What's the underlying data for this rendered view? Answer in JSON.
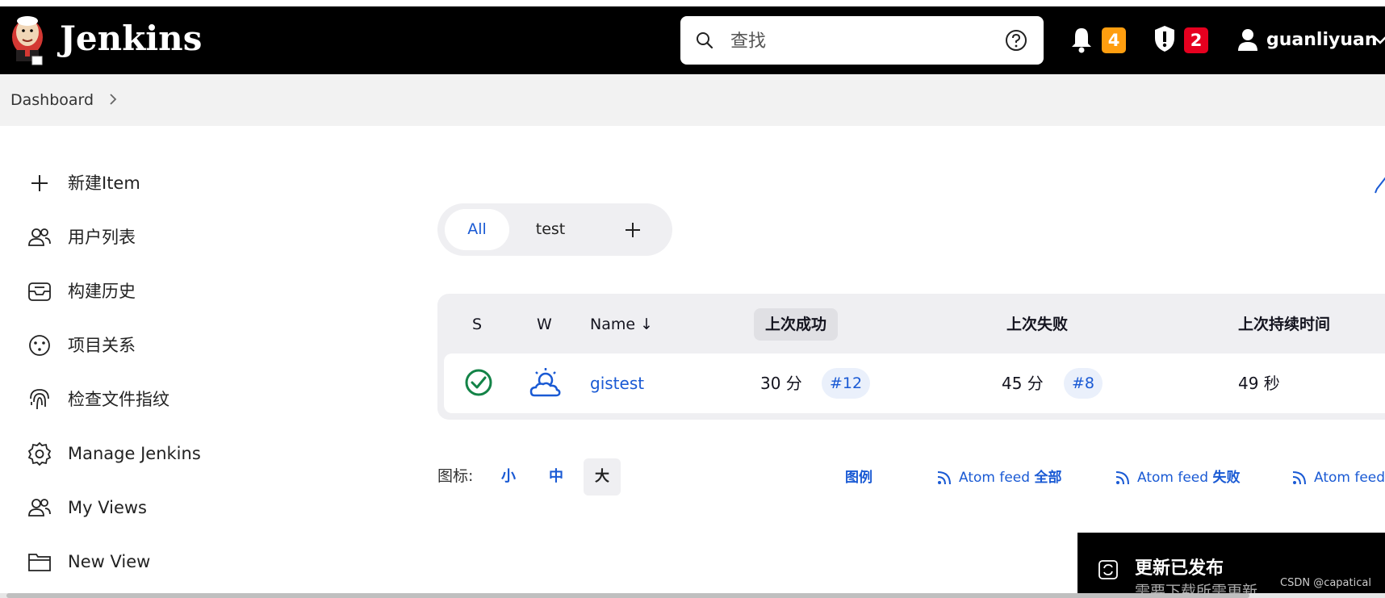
{
  "header": {
    "brand": "Jenkins",
    "search_placeholder": "查找",
    "notifications_count": "4",
    "security_count": "2",
    "username": "guanliyuan"
  },
  "breadcrumb": {
    "item": "Dashboard"
  },
  "sidebar": {
    "items": [
      {
        "label": "新建Item",
        "icon": "plus-icon"
      },
      {
        "label": "用户列表",
        "icon": "people-icon"
      },
      {
        "label": "构建历史",
        "icon": "inbox-icon"
      },
      {
        "label": "项目关系",
        "icon": "relationship-icon"
      },
      {
        "label": "检查文件指纹",
        "icon": "fingerprint-icon"
      },
      {
        "label": "Manage Jenkins",
        "icon": "gear-icon"
      },
      {
        "label": "My Views",
        "icon": "people-icon"
      },
      {
        "label": "New View",
        "icon": "folder-icon"
      }
    ]
  },
  "tabs": {
    "all": "All",
    "test": "test"
  },
  "table": {
    "headers": {
      "s": "S",
      "w": "W",
      "name": "Name ↓",
      "last_success": "上次成功",
      "last_failure": "上次失败",
      "last_duration": "上次持续时间"
    },
    "rows": [
      {
        "name": "gistest",
        "last_success": "30 分",
        "success_build": "#12",
        "last_failure": "45 分",
        "failure_build": "#8",
        "duration": "49 秒",
        "status": "success",
        "weather": "partly-cloudy"
      }
    ]
  },
  "footer": {
    "icon_label": "图标:",
    "sizes": [
      "小",
      "中",
      "大"
    ],
    "legend": "图例",
    "feeds": [
      {
        "prefix": "Atom feed",
        "suffix": "全部"
      },
      {
        "prefix": "Atom feed",
        "suffix": "失败"
      },
      {
        "prefix": "Atom feed",
        "suffix": ""
      }
    ]
  },
  "toast": {
    "title": "更新已发布",
    "subtitle": "需要下载所需更新"
  },
  "watermark": "CSDN @capatical",
  "colors": {
    "header_bg": "#000000",
    "link": "#1a5ad4",
    "badge_orange": "#ff9e0f",
    "badge_red": "#e6001f",
    "success": "#138347"
  }
}
